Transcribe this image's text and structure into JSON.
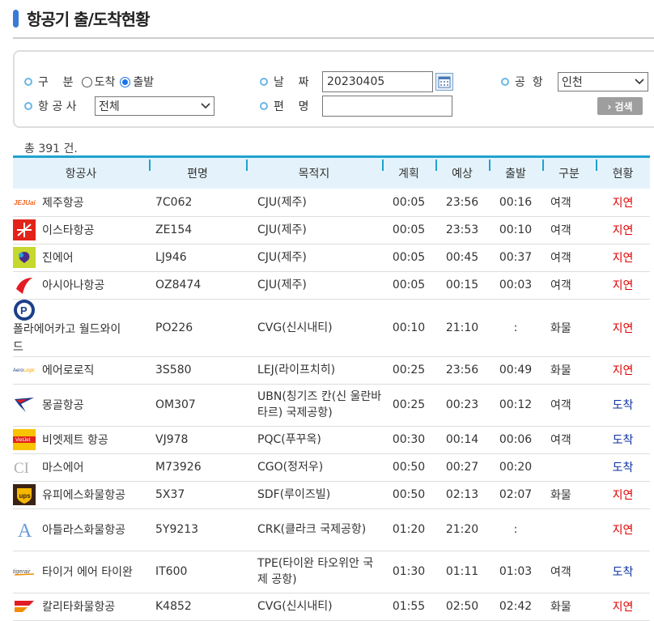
{
  "page": {
    "title": "항공기 출/도착현황"
  },
  "search": {
    "category_label": "구    분",
    "arrival_label": "도착",
    "departure_label": "출발",
    "selected": "departure",
    "date_label": "날    짜",
    "date_value": "20230405",
    "airport_label": "공  항",
    "airport_value": "인천",
    "airline_label": "항 공 사",
    "airline_value": "전체",
    "flight_label": "편    명",
    "flight_value": "",
    "search_button": "› 검색"
  },
  "total": "총 391 건.",
  "table": {
    "headers": [
      "항공사",
      "편명",
      "목적지",
      "계획",
      "예상",
      "출발",
      "구분",
      "현황"
    ],
    "rows": [
      {
        "airline": "제주항공",
        "logo": "jeju-air-logo",
        "flight": "7C062",
        "dest": "CJU(제주)",
        "plan": "00:05",
        "est": "23:56",
        "dep": "00:16",
        "type": "여객",
        "status": "지연"
      },
      {
        "airline": "이스타항공",
        "logo": "eastar-jet-logo",
        "flight": "ZE154",
        "dest": "CJU(제주)",
        "plan": "00:05",
        "est": "23:53",
        "dep": "00:10",
        "type": "여객",
        "status": "지연"
      },
      {
        "airline": "진에어",
        "logo": "jin-air-logo",
        "flight": "LJ946",
        "dest": "CJU(제주)",
        "plan": "00:05",
        "est": "00:45",
        "dep": "00:37",
        "type": "여객",
        "status": "지연"
      },
      {
        "airline": "아시아나항공",
        "logo": "asiana-logo",
        "flight": "OZ8474",
        "dest": "CJU(제주)",
        "plan": "00:05",
        "est": "00:15",
        "dep": "00:03",
        "type": "여객",
        "status": "지연"
      },
      {
        "airline": "폴라에어카고 월드와이드",
        "logo": "polar-air-logo",
        "flight": "PO226",
        "dest": "CVG(신시내티)",
        "plan": "00:10",
        "est": "21:10",
        "dep": ":",
        "type": "화물",
        "status": "지연"
      },
      {
        "airline": "에어로로직",
        "logo": "aerologic-logo",
        "flight": "3S580",
        "dest": "LEJ(라이프치히)",
        "plan": "00:25",
        "est": "23:56",
        "dep": "00:49",
        "type": "화물",
        "status": "지연"
      },
      {
        "airline": "몽골항공",
        "logo": "miat-logo",
        "flight": "OM307",
        "dest": "UBN(칭기즈 칸(신 울란바타르) 국제공항)",
        "plan": "00:25",
        "est": "00:23",
        "dep": "00:12",
        "type": "여객",
        "status": "도착"
      },
      {
        "airline": "비엣제트 항공",
        "logo": "vietjet-logo",
        "flight": "VJ978",
        "dest": "PQC(푸꾸옥)",
        "plan": "00:30",
        "est": "00:14",
        "dep": "00:06",
        "type": "여객",
        "status": "도착"
      },
      {
        "airline": "마스에어",
        "logo": "mas-air-logo",
        "flight": "M73926",
        "dest": "CGO(정저우)",
        "plan": "00:50",
        "est": "00:27",
        "dep": "00:20",
        "type": "",
        "status": "도착"
      },
      {
        "airline": "유피에스화물항공",
        "logo": "ups-logo",
        "flight": "5X37",
        "dest": "SDF(루이즈빌)",
        "plan": "00:50",
        "est": "02:13",
        "dep": "02:07",
        "type": "화물",
        "status": "지연"
      },
      {
        "airline": "아틀라스화물항공",
        "logo": "atlas-air-logo",
        "flight": "5Y9213",
        "dest": "CRK(클라크 국제공항)",
        "plan": "01:20",
        "est": "21:20",
        "dep": ":",
        "type": "",
        "status": "지연"
      },
      {
        "airline": "타이거 에어 타이완",
        "logo": "tigerair-logo",
        "flight": "IT600",
        "dest": "TPE(타이완 타오위안 국제 공항)",
        "plan": "01:30",
        "est": "01:11",
        "dep": "01:03",
        "type": "여객",
        "status": "도착"
      },
      {
        "airline": "칼리타화물항공",
        "logo": "kalitta-logo",
        "flight": "K4852",
        "dest": "CVG(신시내티)",
        "plan": "01:55",
        "est": "02:50",
        "dep": "02:42",
        "type": "화물",
        "status": "지연"
      }
    ]
  },
  "colors": {
    "accent": "#1fa2cf",
    "header_bg": "#e4f3fb",
    "delay": "#e00000",
    "arrive": "#0a2fa0",
    "title_bar": "#3a7bd5"
  }
}
